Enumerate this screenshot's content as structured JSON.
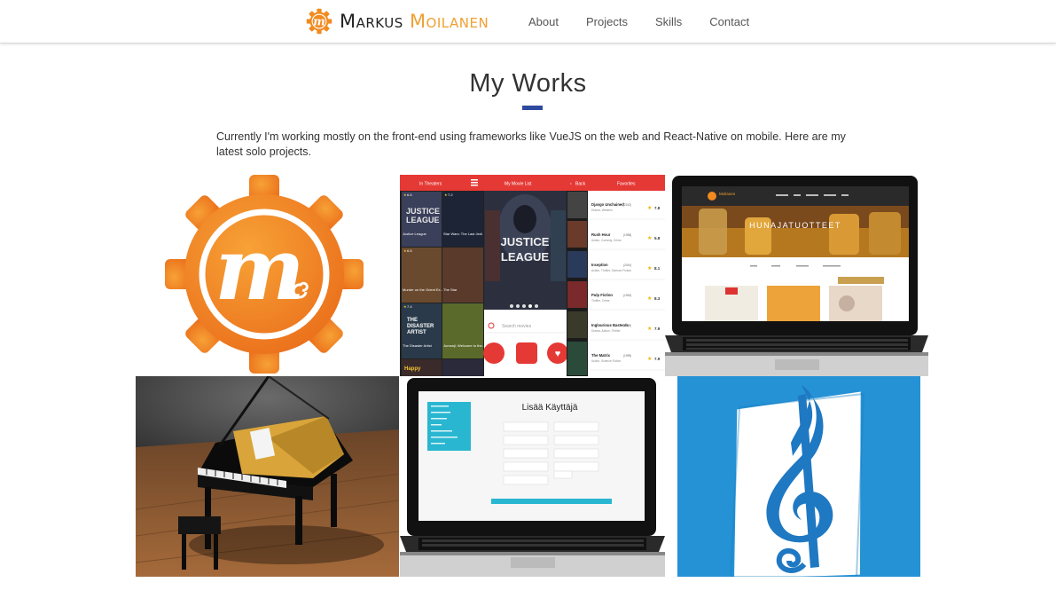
{
  "header": {
    "brand_first": "Markus",
    "brand_last": "Moilanen",
    "brand_logo_letter": "m",
    "nav": [
      "About",
      "Projects",
      "Skills",
      "Contact"
    ]
  },
  "section": {
    "title": "My Works",
    "intro": "Currently I'm working mostly on the front-end using frameworks like VueJS on the web and React-Native on mobile. Here are my latest solo projects."
  },
  "colors": {
    "accent": "#f0a030",
    "underline": "#2e4a9e",
    "logo_orange": "#f28a1f",
    "app_red": "#e53935",
    "cyan": "#29b6d1",
    "music_blue": "#2592d6"
  },
  "projects": {
    "movie_app": {
      "tabs": [
        "In Theaters",
        "My Movie List",
        "Favorites"
      ],
      "back_label": "Back",
      "featured_title": "JUSTICE LEAGUE",
      "search_placeholder": "Search movies",
      "poster_titles": [
        "Justice League",
        "Star Wars: The Last Jedi",
        "Murder on the Orient Ex...",
        "The Star",
        "The Disaster Artist",
        "Jumanji: Welcome to the...",
        "Happy"
      ],
      "poster_ratings": [
        "6.6",
        "7.2",
        "6.6",
        "",
        "7.4",
        "",
        ""
      ],
      "list": [
        {
          "title": "Django Unchained",
          "year": "2012",
          "genre": "Drama, Western",
          "rating": "7.8"
        },
        {
          "title": "Rush Hour",
          "year": "1998",
          "genre": "Action, Comedy, Crime",
          "rating": "5.8"
        },
        {
          "title": "Inception",
          "year": "2010",
          "genre": "Action, Thriller, Science Fiction",
          "rating": "8.1"
        },
        {
          "title": "Pulp Fiction",
          "year": "1994",
          "genre": "Thriller, Crime",
          "rating": "8.3"
        },
        {
          "title": "Inglourious Basterds",
          "year": "2009",
          "genre": "Drama, Action, Thriller",
          "rating": "7.9"
        },
        {
          "title": "The Matrix",
          "year": "1999",
          "genre": "Action, Science Fiction",
          "rating": "7.9"
        }
      ]
    },
    "honey_site": {
      "brand": "Moilanen",
      "hero_title": "HUNAJATUOTTEET"
    },
    "admin_app": {
      "form_title": "Lisää Käyttäjä"
    }
  }
}
